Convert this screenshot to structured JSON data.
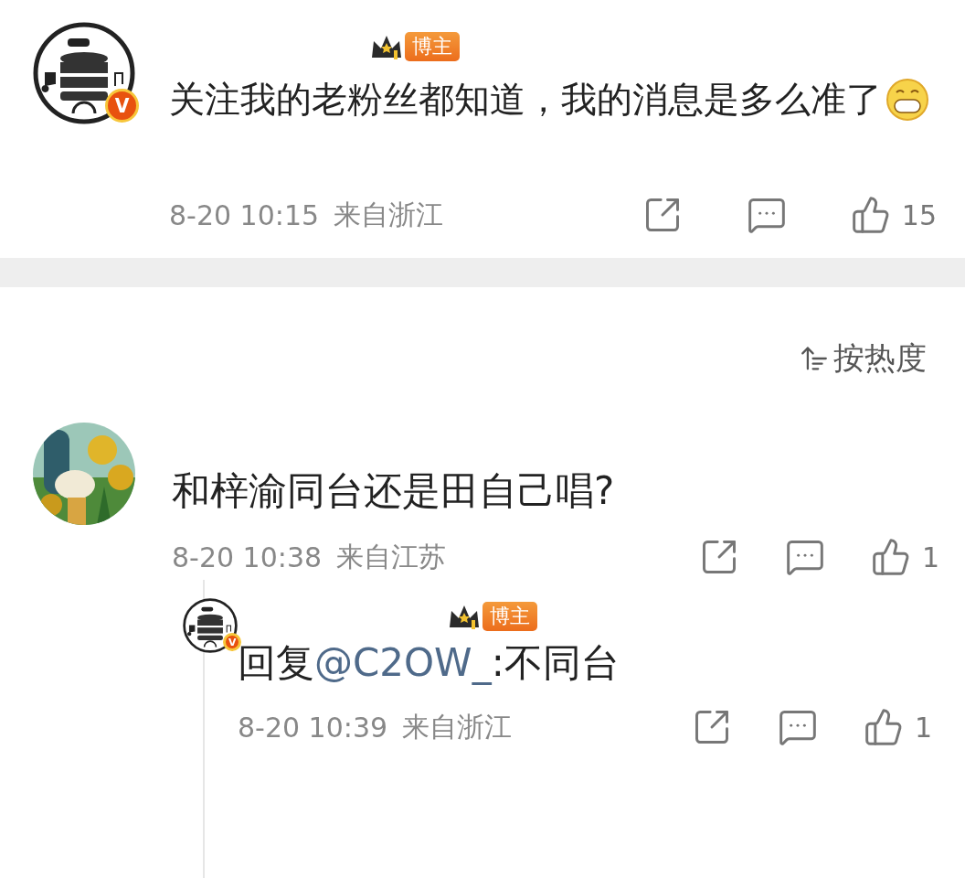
{
  "post": {
    "verified_mark": "V",
    "badge": "博主",
    "text": "关注我的老粉丝都知道，我的消息是多么准了",
    "time": "8-20 10:15",
    "location": "来自浙江",
    "likes": "15"
  },
  "sort": {
    "label": "按热度"
  },
  "comments": [
    {
      "text": "和梓渝同台还是田自己唱?",
      "time": "8-20 10:38",
      "location": "来自江苏",
      "likes": "1",
      "replies": [
        {
          "verified_mark": "V",
          "badge": "博主",
          "prefix": "回复",
          "mention": "@C2OW_",
          "text": ":不同台",
          "time": "8-20 10:39",
          "location": "来自浙江",
          "likes": "1"
        }
      ]
    }
  ]
}
